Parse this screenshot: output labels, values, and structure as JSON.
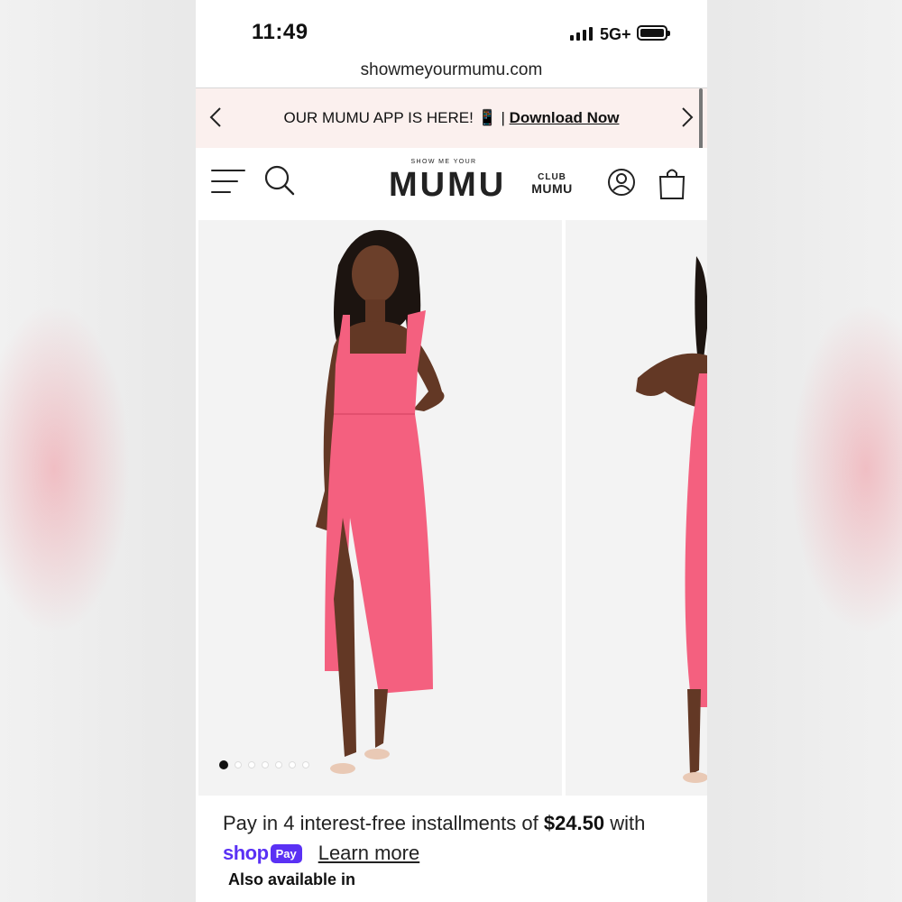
{
  "status_bar": {
    "time": "11:49",
    "network": "5G+"
  },
  "browser": {
    "url": "showmeyourmumu.com"
  },
  "announcement": {
    "text": "OUR MUMU APP IS HERE! 📱 | ",
    "cta": "Download Now",
    "prev_icon": "chevron-left-icon",
    "next_icon": "chevron-right-icon"
  },
  "header": {
    "logo_small": "SHOW ME YOUR",
    "logo_main": "MUMU",
    "club_top": "CLUB",
    "club_bottom": "MUMU",
    "icons": [
      "menu-icon",
      "search-icon",
      "account-icon",
      "shopping-bag-icon"
    ]
  },
  "gallery": {
    "image_count": 7,
    "active_index": 0
  },
  "installments": {
    "text_before": "Pay in 4 interest-free installments of ",
    "amount": "$24.50",
    "text_after": " with",
    "shop_word": "shop",
    "shop_badge": "Pay",
    "learn_more": "Learn more",
    "also_available": "Also available in"
  },
  "colors": {
    "dress_pink": "#f4607f",
    "announcement_bg": "#fbf0ee",
    "shop_pay_purple": "#5a31f4"
  }
}
